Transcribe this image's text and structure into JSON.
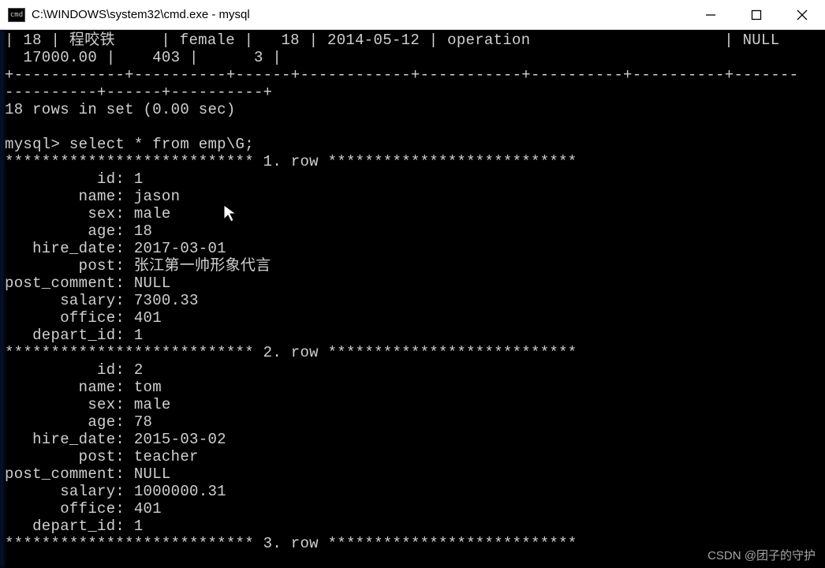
{
  "window": {
    "title": "C:\\WINDOWS\\system32\\cmd.exe - mysql",
    "icon_label": "cmd"
  },
  "terminal": {
    "top_row_left": "| 18 | 程咬铁",
    "top_row_female": "| female",
    "top_row_age": " |   18",
    "top_row_date": " | 2014-05-12",
    "top_row_operation": " | operation",
    "top_row_null": "| NULL",
    "top_row2": "  17000.00 |    403 |      3 |",
    "sep_long": "+------------+----------+------+------------+-----------+----------+----------+-------",
    "sep_short": "----------+------+----------+",
    "rows_in_set": "18 rows in set (0.00 sec)",
    "prompt_line": "mysql> select * from emp\\G;",
    "stars_row_1": "*************************** 1. row ***************************",
    "stars_row_2": "*************************** 2. row ***************************",
    "stars_row_3": "*************************** 3. row ***************************",
    "row1": {
      "id": "          id: 1",
      "name": "        name: jason",
      "sex": "         sex: male",
      "age": "         age: 18",
      "hire_date": "   hire_date: 2017-03-01",
      "post": "        post: 张江第一帅形象代言",
      "post_comment": "post_comment: NULL",
      "salary": "      salary: 7300.33",
      "office": "      office: 401",
      "depart_id": "   depart_id: 1"
    },
    "row2": {
      "id": "          id: 2",
      "name": "        name: tom",
      "sex": "         sex: male",
      "age": "         age: 78",
      "hire_date": "   hire_date: 2015-03-02",
      "post": "        post: teacher",
      "post_comment": "post_comment: NULL",
      "salary": "      salary: 1000000.31",
      "office": "      office: 401",
      "depart_id": "   depart_id: 1"
    }
  },
  "watermark": "CSDN @团子的守护"
}
